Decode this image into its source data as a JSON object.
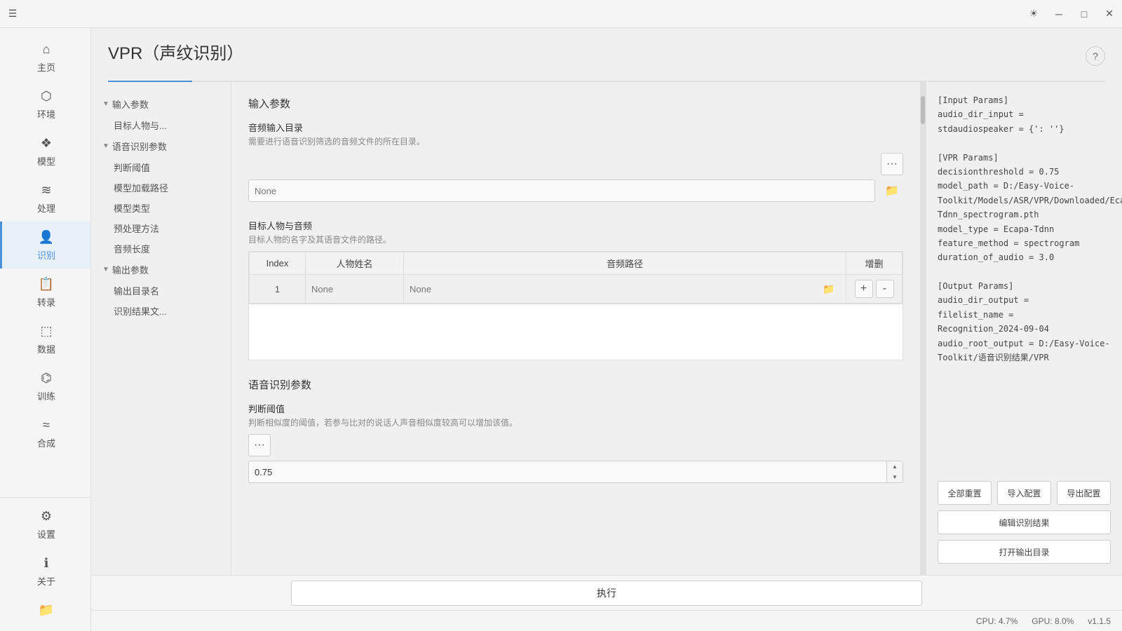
{
  "titlebar": {
    "menu_icon": "☰",
    "theme_icon": "☀",
    "minimize_icon": "─",
    "maximize_icon": "□",
    "close_icon": "✕"
  },
  "sidebar": {
    "items": [
      {
        "id": "home",
        "label": "主页",
        "icon": "⌂"
      },
      {
        "id": "env",
        "label": "环境",
        "icon": "⬡"
      },
      {
        "id": "model",
        "label": "模型",
        "icon": "❖"
      },
      {
        "id": "process",
        "label": "处理",
        "icon": "≋"
      },
      {
        "id": "recognize",
        "label": "识别",
        "icon": "👤",
        "active": true
      },
      {
        "id": "transcribe",
        "label": "转录",
        "icon": "📋"
      },
      {
        "id": "data",
        "label": "数据",
        "icon": "⬚"
      },
      {
        "id": "train",
        "label": "训练",
        "icon": "⌬"
      },
      {
        "id": "synthesize",
        "label": "合成",
        "icon": "≈"
      }
    ],
    "bottom_items": [
      {
        "id": "settings",
        "label": "设置",
        "icon": "⚙"
      },
      {
        "id": "about",
        "label": "关于",
        "icon": "ℹ"
      },
      {
        "id": "folder",
        "label": "",
        "icon": "📁"
      }
    ]
  },
  "page": {
    "title": "VPR（声纹识别）",
    "tab_active": "tab1",
    "tabs": [
      {
        "id": "tab1",
        "label": ""
      }
    ],
    "help_icon": "?"
  },
  "left_nav": {
    "sections": [
      {
        "id": "input-params",
        "label": "输入参数",
        "collapsed": false,
        "items": [
          {
            "id": "target-person",
            "label": "目标人物与..."
          }
        ]
      },
      {
        "id": "voice-params",
        "label": "语音识别参数",
        "collapsed": false,
        "items": [
          {
            "id": "threshold",
            "label": "判断阈值"
          },
          {
            "id": "model-path",
            "label": "模型加载路径"
          },
          {
            "id": "model-type",
            "label": "模型类型"
          },
          {
            "id": "preprocess",
            "label": "预处理方法"
          },
          {
            "id": "audio-len",
            "label": "音频长度"
          }
        ]
      },
      {
        "id": "output-params",
        "label": "输出参数",
        "collapsed": false,
        "items": [
          {
            "id": "output-dir",
            "label": "输出目录名"
          },
          {
            "id": "result-file",
            "label": "识别结果文..."
          }
        ]
      }
    ]
  },
  "main_content": {
    "input_params_title": "输入参数",
    "audio_dir_label": "音频输入目录",
    "audio_dir_desc": "需要进行语音识别筛选的音频文件的所在目录。",
    "audio_dir_value": "",
    "audio_dir_placeholder": "None",
    "target_label": "目标人物与音频",
    "target_desc": "目标人物的名字及其语音文件的路径。",
    "table_headers": [
      "Index",
      "人物姓名",
      "音频路径",
      "增删"
    ],
    "table_rows": [
      {
        "index": "1",
        "name": "None",
        "path": "None"
      }
    ],
    "voice_params_title": "语音识别参数",
    "threshold_label": "判断阈值",
    "threshold_desc": "判断相似度的阈值，若参与比对的说话人声音相似度较高可以增加该值。",
    "threshold_value": "0.75"
  },
  "right_panel": {
    "config_text": "[Input Params]\naudio_dir_input =\nstdaudiospeaker = {': ''}\n\n[VPR Params]\ndecisionthreshold = 0.75\nmodel_path = D:/Easy-Voice-Toolkit/Models/ASR/VPR/Downloaded/Ecapa-Tdnn_spectrogram.pth\nmodel_type = Ecapa-Tdnn\nfeature_method = spectrogram\nduration_of_audio = 3.0\n\n[Output Params]\naudio_dir_output =\nfilelist_name =\nRecognition_2024-09-04\naudio_root_output = D:/Easy-Voice-Toolkit/语音识别结果/VPR",
    "btn_reset": "全部重置",
    "btn_import": "导入配置",
    "btn_export": "导出配置",
    "btn_edit_result": "编辑识别结果",
    "btn_open_output": "打开输出目录"
  },
  "execute": {
    "label": "执行"
  },
  "statusbar": {
    "cpu": "CPU: 4.7%",
    "gpu": "GPU: 8.0%",
    "version": "v1.1.5"
  }
}
